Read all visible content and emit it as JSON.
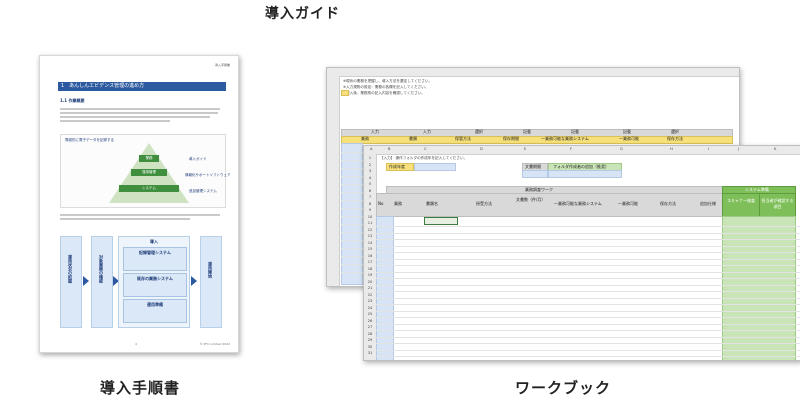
{
  "page_title": "導入ガイド",
  "captions": {
    "document": "導入手順書",
    "workbook": "ワークブック"
  },
  "document": {
    "header_tag": "導入手順書",
    "chapter": "1　あんしんエビデンス管理の進め方",
    "section": "1.1 作業概要",
    "pyramid_top": "業務",
    "pyramid_mid": "運用管理",
    "pyramid_base": "システム",
    "figure1_title": "電磁的に電子データを記録する",
    "figure1_side": [
      "導入ガイド",
      "情報化サポートソフトウェア",
      "追加管理システム"
    ],
    "steps": [
      "運用状況の把握",
      "対象業務の確認",
      "運用開始"
    ],
    "stack_title": "導入",
    "stack_items": [
      "記録管理システム",
      "既存の業務システム",
      "運用準備"
    ],
    "footer": "© PFU Limited 2022",
    "page_number": "4"
  },
  "workbook": {
    "back_notes": [
      "※現状の業務を把握し、導入方法を選定してください。",
      "※入力規則の設定：業務の各欄を記入してください。",
      "※記入後、業務別の記入内容を確認してください。"
    ],
    "back_header_cells": [
      "入力",
      "入力",
      "選択",
      "記載",
      "記載",
      "記載",
      "選択"
    ],
    "back_header_cells2": [
      "業務",
      "書類",
      "保管方法",
      "保存期間",
      "一業務可能な業務システム",
      "一業務可能",
      "保存方法"
    ],
    "front_title_note": "【入力】 操作フォルダの作成年を記入してください。",
    "front_label_year": "作成年度",
    "front_label_period": "文書期間",
    "front_label_folder": "フォルダ作成者の追加（推奨）",
    "front_band": "業務調査ワーク",
    "front_band_right": "システム準備",
    "column_letters": [
      "A",
      "B",
      "C",
      "D",
      "E",
      "F",
      "G",
      "H",
      "I",
      "J",
      "K"
    ],
    "columns": [
      "No",
      "業務",
      "書類名",
      "授受方法",
      "文書数（件/月）",
      "一業務可能な業務システム",
      "一業務可能",
      "保存方法",
      "追加仕様",
      "スキャナー検査",
      "担当者が確認する項目"
    ],
    "row_numbers": [
      "1",
      "2",
      "3",
      "4",
      "5",
      "6",
      "7",
      "8",
      "9",
      "10",
      "11",
      "12",
      "13",
      "14",
      "15",
      "16",
      "17",
      "18",
      "19",
      "20",
      "21",
      "22",
      "23",
      "24",
      "25",
      "26",
      "27",
      "28",
      "29",
      "30",
      "31"
    ]
  }
}
